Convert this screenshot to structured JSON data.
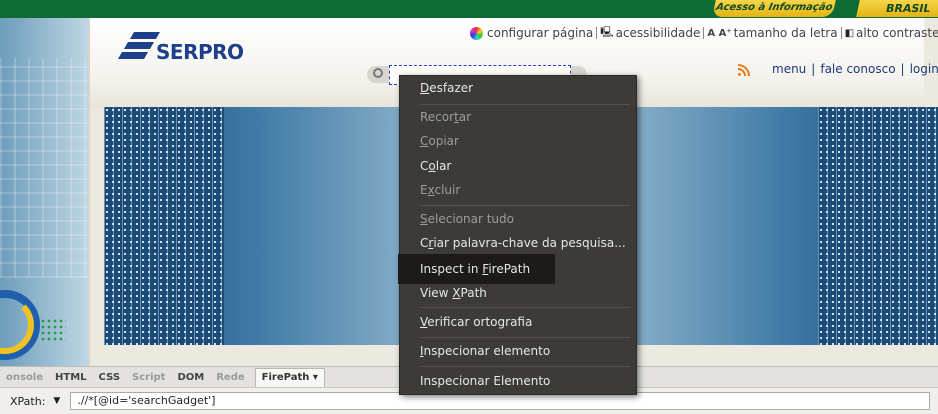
{
  "gov_bar": {
    "acesso": "Acesso à Informação",
    "brasil": "BRASIL"
  },
  "logo": {
    "text": "SERPRO"
  },
  "utility_links": {
    "configurar": "configurar página",
    "acessibilidade": "acessibilidade",
    "tamanho_prefix": "A A⁺",
    "tamanho": "tamanho da letra",
    "contraste": "alto contraste"
  },
  "right_nav": {
    "menu": "menu",
    "sep1": "|",
    "fale": "fale conosco",
    "sep2": "|",
    "login": "login"
  },
  "search": {
    "value": ""
  },
  "context_menu": {
    "items": [
      {
        "pre": "",
        "u": "D",
        "post": "esfazer"
      },
      {
        "pre": "Recor",
        "u": "t",
        "post": "ar"
      },
      {
        "pre": "",
        "u": "C",
        "post": "opiar"
      },
      {
        "pre": "C",
        "u": "o",
        "post": "lar"
      },
      {
        "pre": "E",
        "u": "x",
        "post": "cluir"
      },
      {
        "pre": "",
        "u": "S",
        "post": "elecionar tudo"
      },
      {
        "pre": "C",
        "u": "r",
        "post": "iar palavra-chave da pesquisa..."
      },
      {
        "pre": "Inspect in ",
        "u": "F",
        "post": "irePath"
      },
      {
        "pre": "View ",
        "u": "X",
        "post": "Path"
      },
      {
        "pre": "",
        "u": "V",
        "post": "erificar ortografia"
      },
      {
        "pre": "",
        "u": "I",
        "post": "nspecionar elemento"
      },
      {
        "pre": "Inspecionar Elemento",
        "u": "",
        "post": ""
      }
    ]
  },
  "devtools": {
    "tabs": [
      "onsole",
      "HTML",
      "CSS",
      "Script",
      "DOM",
      "Rede",
      "FirePath ▾"
    ],
    "xpath_label": "XPath:",
    "xpath_dropdown": "▼",
    "xpath_value": ".//*[@id='searchGadget']"
  }
}
